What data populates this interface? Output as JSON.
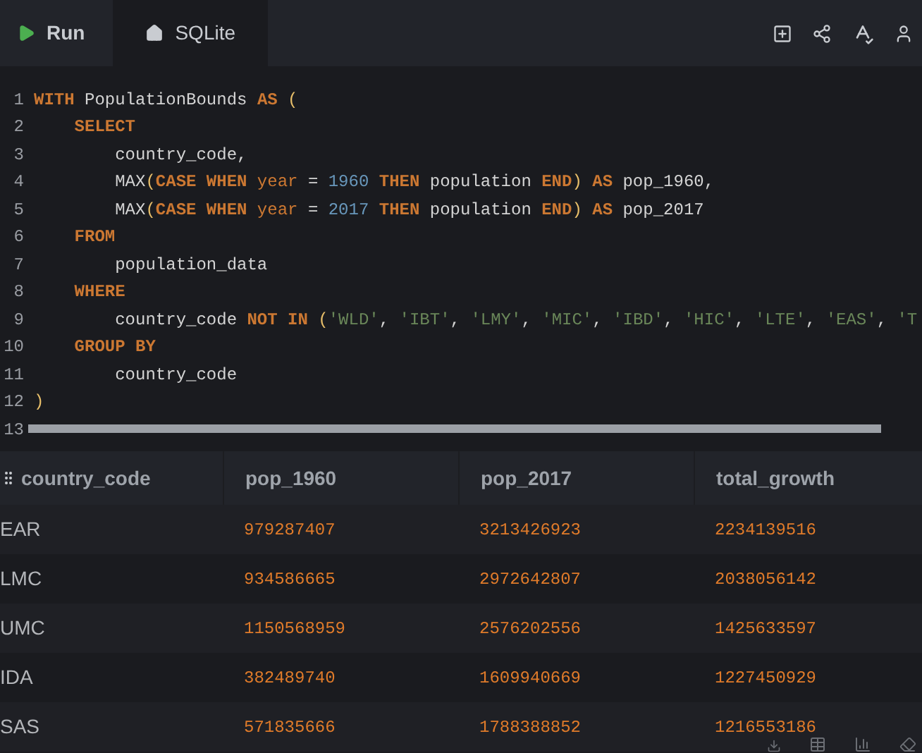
{
  "tabs": [
    {
      "label": "Run",
      "kind": "run"
    },
    {
      "label": "SQLite",
      "kind": "home"
    }
  ],
  "code_lines": [
    {
      "number": "1",
      "tokens": [
        {
          "t": "WITH",
          "kind": "kw"
        },
        {
          "t": " PopulationBounds ",
          "kind": "plain"
        },
        {
          "t": "AS",
          "kind": "kw"
        },
        {
          "t": " (",
          "kind": "paren"
        }
      ]
    },
    {
      "number": "2",
      "tokens": [
        {
          "t": "    SELECT",
          "kind": "kw"
        }
      ]
    },
    {
      "number": "3",
      "tokens": [
        {
          "t": "        country_code,",
          "kind": "plain"
        }
      ]
    },
    {
      "number": "4",
      "tokens": [
        {
          "t": "        MAX",
          "kind": "plain"
        },
        {
          "t": "(",
          "kind": "paren"
        },
        {
          "t": "CASE WHEN",
          "kind": "kw"
        },
        {
          "t": " year",
          "kind": "ident"
        },
        {
          "t": " = ",
          "kind": "plain"
        },
        {
          "t": "1960",
          "kind": "num"
        },
        {
          "t": " THEN",
          "kind": "kw"
        },
        {
          "t": " population ",
          "kind": "plain"
        },
        {
          "t": "END",
          "kind": "kw"
        },
        {
          "t": ")",
          "kind": "paren"
        },
        {
          "t": " AS",
          "kind": "kw"
        },
        {
          "t": " pop_1960,",
          "kind": "plain"
        }
      ]
    },
    {
      "number": "5",
      "tokens": [
        {
          "t": "        MAX",
          "kind": "plain"
        },
        {
          "t": "(",
          "kind": "paren"
        },
        {
          "t": "CASE WHEN",
          "kind": "kw"
        },
        {
          "t": " year",
          "kind": "ident"
        },
        {
          "t": " = ",
          "kind": "plain"
        },
        {
          "t": "2017",
          "kind": "num"
        },
        {
          "t": " THEN",
          "kind": "kw"
        },
        {
          "t": " population ",
          "kind": "plain"
        },
        {
          "t": "END",
          "kind": "kw"
        },
        {
          "t": ")",
          "kind": "paren"
        },
        {
          "t": " AS",
          "kind": "kw"
        },
        {
          "t": " pop_2017",
          "kind": "plain"
        }
      ]
    },
    {
      "number": "6",
      "tokens": [
        {
          "t": "    FROM",
          "kind": "kw"
        }
      ]
    },
    {
      "number": "7",
      "tokens": [
        {
          "t": "        population_data",
          "kind": "plain"
        }
      ]
    },
    {
      "number": "8",
      "tokens": [
        {
          "t": "    WHERE",
          "kind": "kw"
        }
      ]
    },
    {
      "number": "9",
      "tokens": [
        {
          "t": "        country_code ",
          "kind": "plain"
        },
        {
          "t": "NOT IN",
          "kind": "kw"
        },
        {
          "t": " (",
          "kind": "paren"
        },
        {
          "t": "'WLD'",
          "kind": "str"
        },
        {
          "t": ", ",
          "kind": "plain"
        },
        {
          "t": "'IBT'",
          "kind": "str"
        },
        {
          "t": ", ",
          "kind": "plain"
        },
        {
          "t": "'LMY'",
          "kind": "str"
        },
        {
          "t": ", ",
          "kind": "plain"
        },
        {
          "t": "'MIC'",
          "kind": "str"
        },
        {
          "t": ", ",
          "kind": "plain"
        },
        {
          "t": "'IBD'",
          "kind": "str"
        },
        {
          "t": ", ",
          "kind": "plain"
        },
        {
          "t": "'HIC'",
          "kind": "str"
        },
        {
          "t": ", ",
          "kind": "plain"
        },
        {
          "t": "'LTE'",
          "kind": "str"
        },
        {
          "t": ", ",
          "kind": "plain"
        },
        {
          "t": "'EAS'",
          "kind": "str"
        },
        {
          "t": ", ",
          "kind": "plain"
        },
        {
          "t": "'T",
          "kind": "str"
        }
      ]
    },
    {
      "number": "10",
      "tokens": [
        {
          "t": "    GROUP BY",
          "kind": "kw"
        }
      ]
    },
    {
      "number": "11",
      "tokens": [
        {
          "t": "        country_code",
          "kind": "plain"
        }
      ]
    },
    {
      "number": "12",
      "tokens": [
        {
          "t": ")",
          "kind": "paren"
        }
      ]
    },
    {
      "number": "13"
    }
  ],
  "table": {
    "columns": [
      "country_code",
      "pop_1960",
      "pop_2017",
      "total_growth"
    ],
    "rows": [
      [
        "EAR",
        "979287407",
        "3213426923",
        "2234139516"
      ],
      [
        "LMC",
        "934586665",
        "2972642807",
        "2038056142"
      ],
      [
        "UMC",
        "1150568959",
        "2576202556",
        "1425633597"
      ],
      [
        "IDA",
        "382489740",
        "1609940669",
        "1227450929"
      ],
      [
        "SAS",
        "571835666",
        "1788388852",
        "1216553186"
      ]
    ]
  }
}
